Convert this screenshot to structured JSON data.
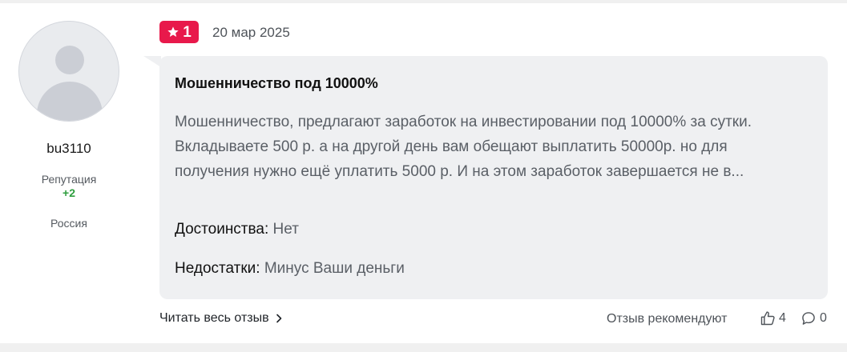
{
  "author": {
    "username": "bu3110",
    "reputation_label": "Репутация",
    "reputation_value": "+2",
    "country": "Россия",
    "avatar_icon": "user-avatar-placeholder-icon"
  },
  "review": {
    "rating": "1",
    "rating_icon": "star-icon",
    "date": "20 мар 2025",
    "title": "Мошенничество под 10000%",
    "text": "Мошенничество, предлагают заработок на инвестировании под 10000% за сутки. Вкладываете 500 р. а на другой день вам обещают выплатить 50000р. но для получения нужно ещё уплатить 5000 р. И на этом заработок завершается не в...",
    "pros_label": "Достоинства:",
    "pros_value": "Нет",
    "cons_label": "Недостатки:",
    "cons_value": "Минус Ваши деньги"
  },
  "footer": {
    "read_more": "Читать весь отзыв",
    "recommend_text": "Отзыв рекомендуют",
    "likes_count": "4",
    "comments_count": "0"
  },
  "colors": {
    "badge": "#e8194b",
    "reputation_positive": "#2e9e3e",
    "bubble_bg": "#eff0f2"
  }
}
